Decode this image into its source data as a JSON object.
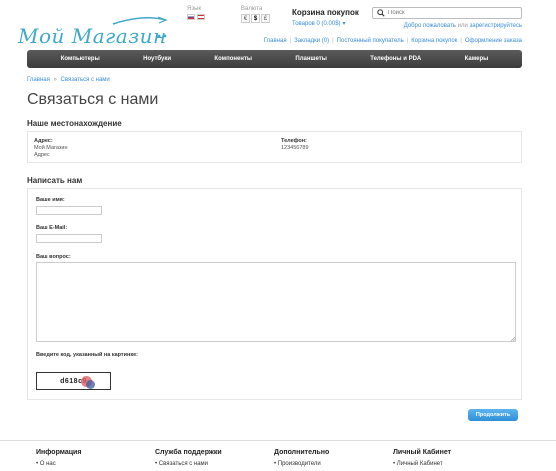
{
  "header": {
    "logo_text": "Мой Магазин",
    "language_label": "Язык",
    "currency_label": "Валюта",
    "currencies": [
      "€",
      "$",
      "£"
    ],
    "active_currency": "$",
    "cart_title": "Корзина покупок",
    "cart_summary": "Товаров 0 (0.00$)",
    "search_placeholder": "Поиск",
    "welcome_text": "Добро пожаловать",
    "welcome_link": "зарегистрируйтесь"
  },
  "top_links": [
    "Главная",
    "Закладки (0)",
    "Постоянный покупатель",
    "Корзина покупок",
    "Оформление заказа"
  ],
  "menu": [
    "Компьютеры",
    "Ноутбуки",
    "Компоненты",
    "Планшеты",
    "Телефоны и PDA",
    "Камеры"
  ],
  "breadcrumb": [
    "Главная",
    "Связаться с нами"
  ],
  "page_title": "Связаться с нами",
  "location": {
    "section_title": "Наше местонахождение",
    "address_label": "Адрес:",
    "address_line1": "Мой Магазин",
    "address_line2": "Адрес",
    "phone_label": "Телефон:",
    "phone_value": "123456789"
  },
  "form": {
    "section_title": "Написать нам",
    "name_label": "Ваше имя:",
    "email_label": "Ваш E-Mail:",
    "question_label": "Ваш вопрос:",
    "captcha_label": "Введите код, указанный на картинке:",
    "captcha_code": "d618c9",
    "submit_label": "Продолжить"
  },
  "footer": {
    "columns": [
      {
        "title": "Информация",
        "items": [
          "О нас"
        ]
      },
      {
        "title": "Служба поддержки",
        "items": [
          "Связаться с нами"
        ]
      },
      {
        "title": "Дополнительно",
        "items": [
          "Производители"
        ]
      },
      {
        "title": "Личный Кабинет",
        "items": [
          "Личный Кабинет"
        ]
      }
    ]
  },
  "colors": {
    "accent": "#3a8dde",
    "logo": "#3fa9c9",
    "menu_bg": "#4a4a4a",
    "button": "#2f8fd8"
  }
}
